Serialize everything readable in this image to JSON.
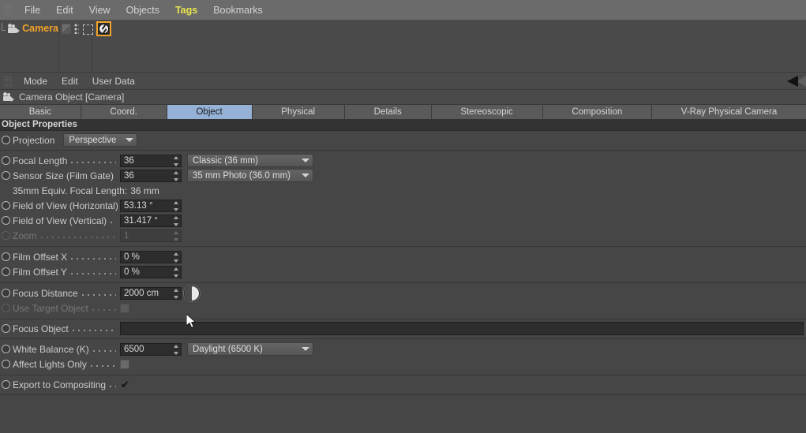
{
  "menubar": {
    "items": [
      {
        "label": "File",
        "active": false
      },
      {
        "label": "Edit",
        "active": false
      },
      {
        "label": "View",
        "active": false
      },
      {
        "label": "Objects",
        "active": false
      },
      {
        "label": "Tags",
        "active": true
      },
      {
        "label": "Bookmarks",
        "active": false
      }
    ],
    "active_color": "#e8e44e"
  },
  "object_manager": {
    "object_name": "Camera",
    "object_name_color": "#f0a32a",
    "icons": [
      "material-icon",
      "dots-icon",
      "move-icon"
    ],
    "selected_tag": "camera-shutter-tag"
  },
  "attribute_manager": {
    "menu": [
      {
        "label": "Mode"
      },
      {
        "label": "Edit"
      },
      {
        "label": "User Data"
      }
    ],
    "title": "Camera Object [Camera]",
    "tabs": [
      {
        "label": "Basic",
        "active": false
      },
      {
        "label": "Coord.",
        "active": false
      },
      {
        "label": "Object",
        "active": true
      },
      {
        "label": "Physical",
        "active": false
      },
      {
        "label": "Details",
        "active": false
      },
      {
        "label": "Stereoscopic",
        "active": false
      },
      {
        "label": "Composition",
        "active": false
      },
      {
        "label": "V-Ray Physical Camera",
        "active": false
      }
    ],
    "active_tab_color": "#95b2d6"
  },
  "object_properties": {
    "section_title": "Object Properties",
    "projection": {
      "label": "Projection",
      "value": "Perspective"
    },
    "focal_length": {
      "label": "Focal Length",
      "value": "36",
      "preset": "Classic (36 mm)"
    },
    "sensor_size": {
      "label": "Sensor Size (Film Gate)",
      "value": "36",
      "preset": "35 mm Photo (36.0 mm)"
    },
    "equiv_focal_length": {
      "label": "35mm Equiv. Focal Length:",
      "value": "36 mm"
    },
    "fov_horizontal": {
      "label": "Field of View (Horizontal)",
      "value": "53.13 °"
    },
    "fov_vertical": {
      "label": "Field of View (Vertical)",
      "value": "31.417 °"
    },
    "zoom": {
      "label": "Zoom",
      "value": "1",
      "disabled": true
    },
    "film_offset_x": {
      "label": "Film Offset X",
      "value": "0 %"
    },
    "film_offset_y": {
      "label": "Film Offset Y",
      "value": "0 %"
    },
    "focus_distance": {
      "label": "Focus Distance",
      "value": "2000 cm"
    },
    "use_target_object": {
      "label": "Use Target Object",
      "checked": false,
      "disabled": true
    },
    "focus_object": {
      "label": "Focus Object",
      "value": ""
    },
    "white_balance": {
      "label": "White Balance (K)",
      "value": "6500",
      "preset": "Daylight (6500 K)"
    },
    "affect_lights_only": {
      "label": "Affect Lights Only",
      "checked": false
    },
    "export_to_compositing": {
      "label": "Export to Compositing",
      "checked": true,
      "mark": "✔"
    }
  }
}
